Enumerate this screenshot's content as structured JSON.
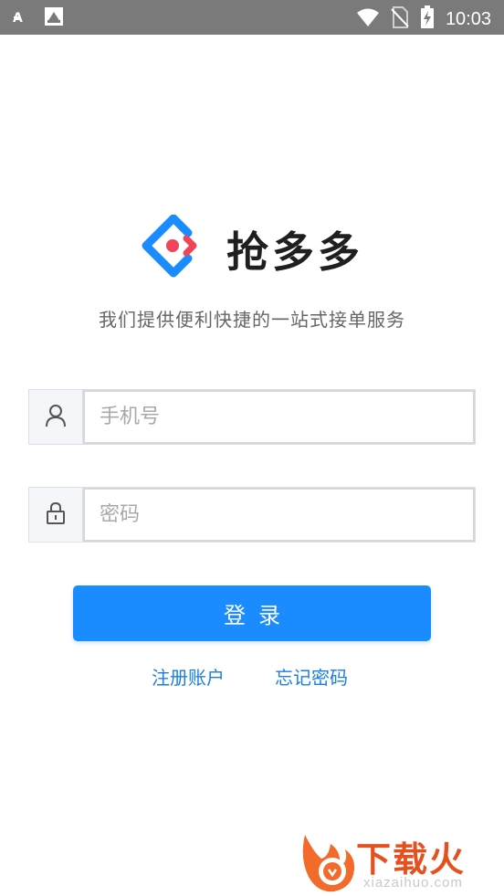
{
  "status_bar": {
    "time": "10:03",
    "icons": [
      "font-icon",
      "screenshot-icon",
      "wifi-icon",
      "no-sim-icon",
      "battery-charging-icon"
    ]
  },
  "app": {
    "name": "抢多多",
    "slogan": "我们提供便利快捷的一站式接单服务",
    "logo_colors": {
      "blue": "#1a8cff",
      "red": "#f0445a"
    }
  },
  "form": {
    "phone_placeholder": "手机号",
    "phone_value": "",
    "password_placeholder": "密码",
    "password_value": "",
    "login_label": "登录",
    "register_link": "注册账户",
    "forgot_link": "忘记密码"
  },
  "watermark": {
    "brand": "下载火",
    "url": "xiazaihuo.com"
  },
  "colors": {
    "accent": "#1a8cff",
    "status_bar": "#7a7a7a"
  }
}
